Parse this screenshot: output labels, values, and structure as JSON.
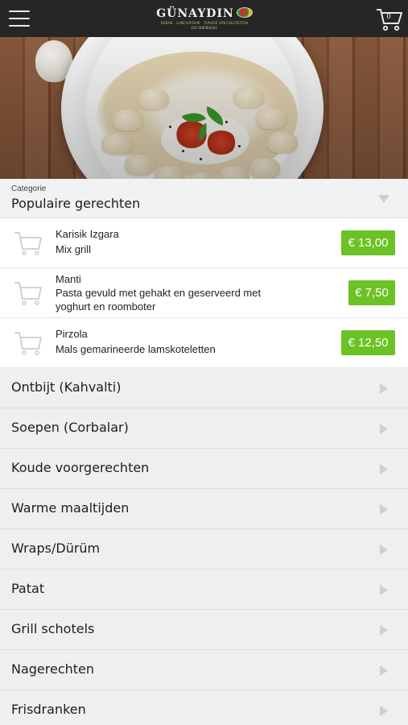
{
  "header": {
    "logo_title": "GÜNAYDIN",
    "logo_tagline": "KEBAB · LUNCHROOM · TURKSE SPECIALITEITEN",
    "logo_subtitle": "OCAKBASI",
    "cart_count": "0"
  },
  "category": {
    "label": "Categorie",
    "selected": "Populaire gerechten"
  },
  "dishes": [
    {
      "name": "Karisik Izgara",
      "description": "Mix grill",
      "price": "€ 13,00"
    },
    {
      "name": "Manti",
      "description": "Pasta gevuld met gehakt en geserveerd met yoghurt en roomboter",
      "price": "€ 7,50"
    },
    {
      "name": "Pirzola",
      "description": "Mals gemarineerde lamskoteletten",
      "price": "€ 12,50"
    }
  ],
  "categories": [
    {
      "label": "Ontbijt (Kahvalti)"
    },
    {
      "label": "Soepen (Corbalar)"
    },
    {
      "label": "Koude voorgerechten"
    },
    {
      "label": "Warme maaltijden"
    },
    {
      "label": "Wraps/Dürüm"
    },
    {
      "label": "Patat"
    },
    {
      "label": "Grill schotels"
    },
    {
      "label": "Nagerechten"
    },
    {
      "label": "Frisdranken"
    }
  ],
  "colors": {
    "header_bg": "#262626",
    "price_badge": "#6bc224",
    "list_bg": "#efefef"
  },
  "icons": {
    "menu": "hamburger-menu-icon",
    "cart": "shopping-cart-icon",
    "dropdown": "triangle-down-icon",
    "row_arrow": "triangle-right-icon"
  }
}
